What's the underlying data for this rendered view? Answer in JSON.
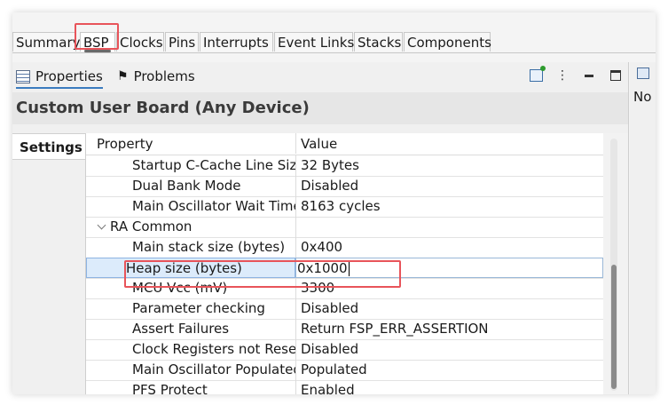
{
  "editor_tabs": [
    {
      "label": "Summary"
    },
    {
      "label": "BSP",
      "active": true
    },
    {
      "label": "Clocks"
    },
    {
      "label": "Pins"
    },
    {
      "label": "Interrupts"
    },
    {
      "label": "Event Links"
    },
    {
      "label": "Stacks"
    },
    {
      "label": "Components"
    }
  ],
  "view_tabs": {
    "properties": "Properties",
    "problems": "Problems"
  },
  "board_title": "Custom User Board (Any Device)",
  "settings_tab": "Settings",
  "table": {
    "col_property": "Property",
    "col_value": "Value",
    "rows": [
      {
        "property": "Startup C-Cache Line Size",
        "value": "32 Bytes"
      },
      {
        "property": "Dual Bank Mode",
        "value": "Disabled"
      },
      {
        "property": "Main Oscillator Wait Time",
        "value": "8163 cycles"
      },
      {
        "property": "RA Common",
        "value": "",
        "group": true
      },
      {
        "property": "Main stack size (bytes)",
        "value": "0x400"
      },
      {
        "property": "Heap size (bytes)",
        "value": "0x1000",
        "selected": true
      },
      {
        "property": "MCU Vcc (mV)",
        "value": "3300"
      },
      {
        "property": "Parameter checking",
        "value": "Disabled"
      },
      {
        "property": "Assert Failures",
        "value": "Return FSP_ERR_ASSERTION"
      },
      {
        "property": "Clock Registers not Reset",
        "value": "Disabled"
      },
      {
        "property": "Main Oscillator Populated",
        "value": "Populated"
      },
      {
        "property": "PFS Protect",
        "value": "Enabled"
      }
    ]
  },
  "right_panel_label": "No",
  "colors": {
    "highlight": "#e8545a",
    "selection": "#dcebfb"
  }
}
